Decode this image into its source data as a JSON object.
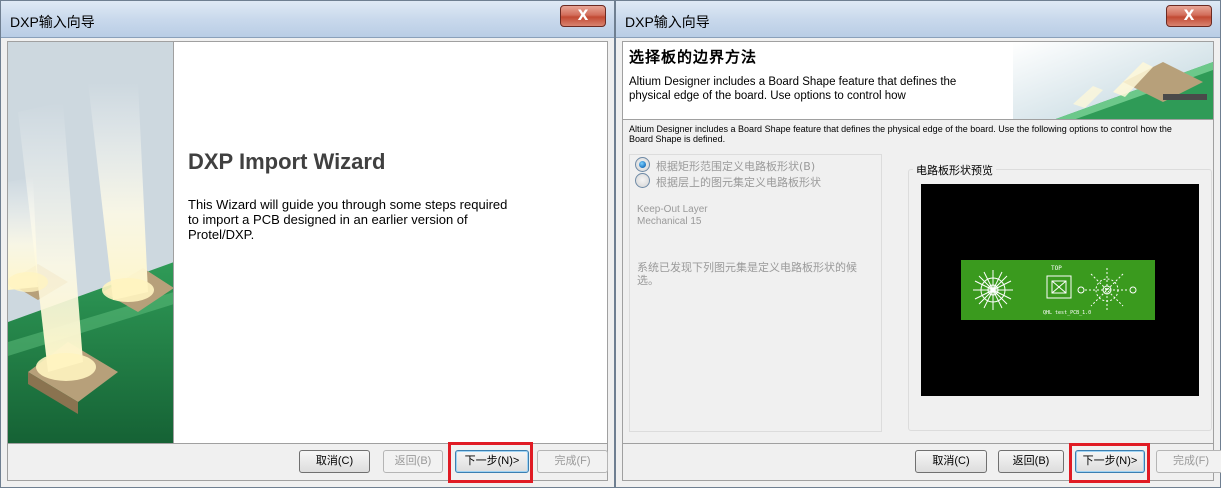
{
  "left_window": {
    "title": "DXP输入向导",
    "close_glyph": "X",
    "heading": "DXP Import Wizard",
    "description": "This Wizard will guide you through some steps required to import a PCB designed in an earlier version of Protel/DXP.",
    "buttons": {
      "cancel": "取消(C)",
      "back": "返回(B)",
      "next": "下一步(N)>",
      "finish": "完成(F)"
    },
    "highlighted_button": "next"
  },
  "right_window": {
    "title": "DXP输入向导",
    "close_glyph": "X",
    "header_title": "选择板的边界方法",
    "header_subtitle": "Altium Designer includes a Board Shape feature that defines the physical edge of the board. Use options to control how",
    "intro": "Altium Designer includes a Board Shape feature that defines the physical edge of the board. Use the following options to control how the Board Shape is defined.",
    "options": [
      {
        "label": "根据矩形范围定义电路板形状(B)",
        "selected": true
      },
      {
        "label": "根据层上的图元集定义电路板形状",
        "selected": false
      }
    ],
    "layers": [
      "Keep-Out Layer",
      "Mechanical 15"
    ],
    "found_text": "系统已发现下列图元集是定义电路板形状的候选。",
    "preview_label": "电路板形状预览",
    "preview": {
      "background_color": "#000000",
      "board_color": "#3a9a1e",
      "board_text_top": "TOP",
      "board_text_bottom": "QHL test_PCB_1.0"
    },
    "buttons": {
      "cancel": "取消(C)",
      "back": "返回(B)",
      "next": "下一步(N)>",
      "finish": "完成(F)"
    },
    "highlighted_button": "next"
  },
  "colors": {
    "highlight": "#e01b24",
    "title_bar": "#c9d9ec",
    "close_button": "#c24a33"
  }
}
